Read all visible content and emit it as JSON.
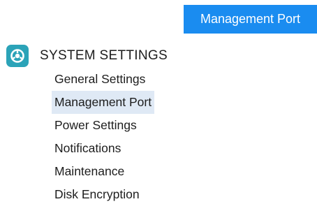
{
  "header": {
    "active_button_label": "Management Port"
  },
  "sidebar": {
    "section": {
      "title": "SYSTEM SETTINGS",
      "icon": "settings-icon",
      "icon_color": "#2ba3b8"
    },
    "items": [
      {
        "label": "General Settings",
        "selected": false
      },
      {
        "label": "Management Port",
        "selected": true
      },
      {
        "label": "Power Settings",
        "selected": false
      },
      {
        "label": "Notifications",
        "selected": false
      },
      {
        "label": "Maintenance",
        "selected": false
      },
      {
        "label": "Disk Encryption",
        "selected": false
      }
    ]
  },
  "colors": {
    "accent": "#1a8cf0",
    "selected_bg": "#dfe9f5"
  }
}
